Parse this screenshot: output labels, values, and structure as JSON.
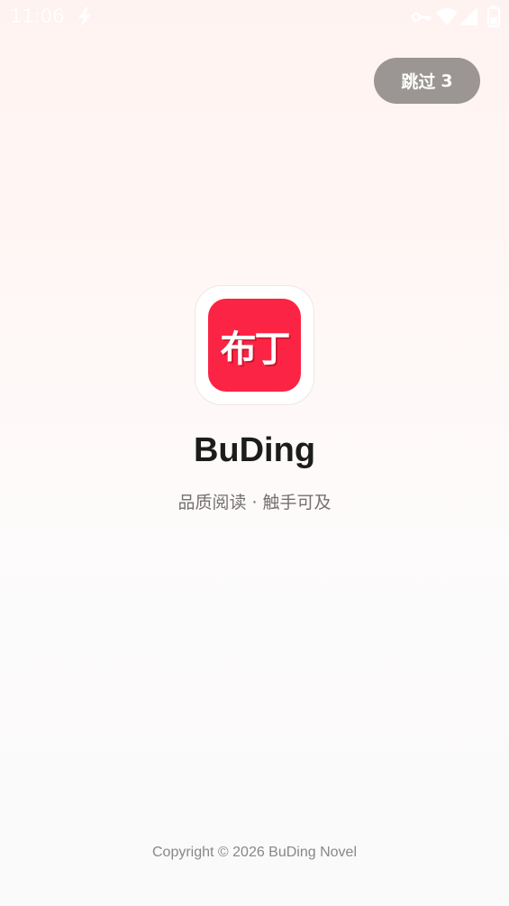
{
  "status_bar": {
    "time": "11:06",
    "icons": [
      "flash-icon",
      "vpn-key-icon",
      "wifi-icon",
      "cellular-signal-icon",
      "battery-icon"
    ]
  },
  "skip_button": {
    "label": "跳过",
    "countdown": "3",
    "color": "#9b9593"
  },
  "logo": {
    "text": "布丁",
    "accent_color": "#fc2444"
  },
  "app": {
    "name": "BuDing",
    "tagline": "品质阅读 · 触手可及"
  },
  "footer": {
    "copyright": "Copyright © 2026 BuDing Novel"
  }
}
